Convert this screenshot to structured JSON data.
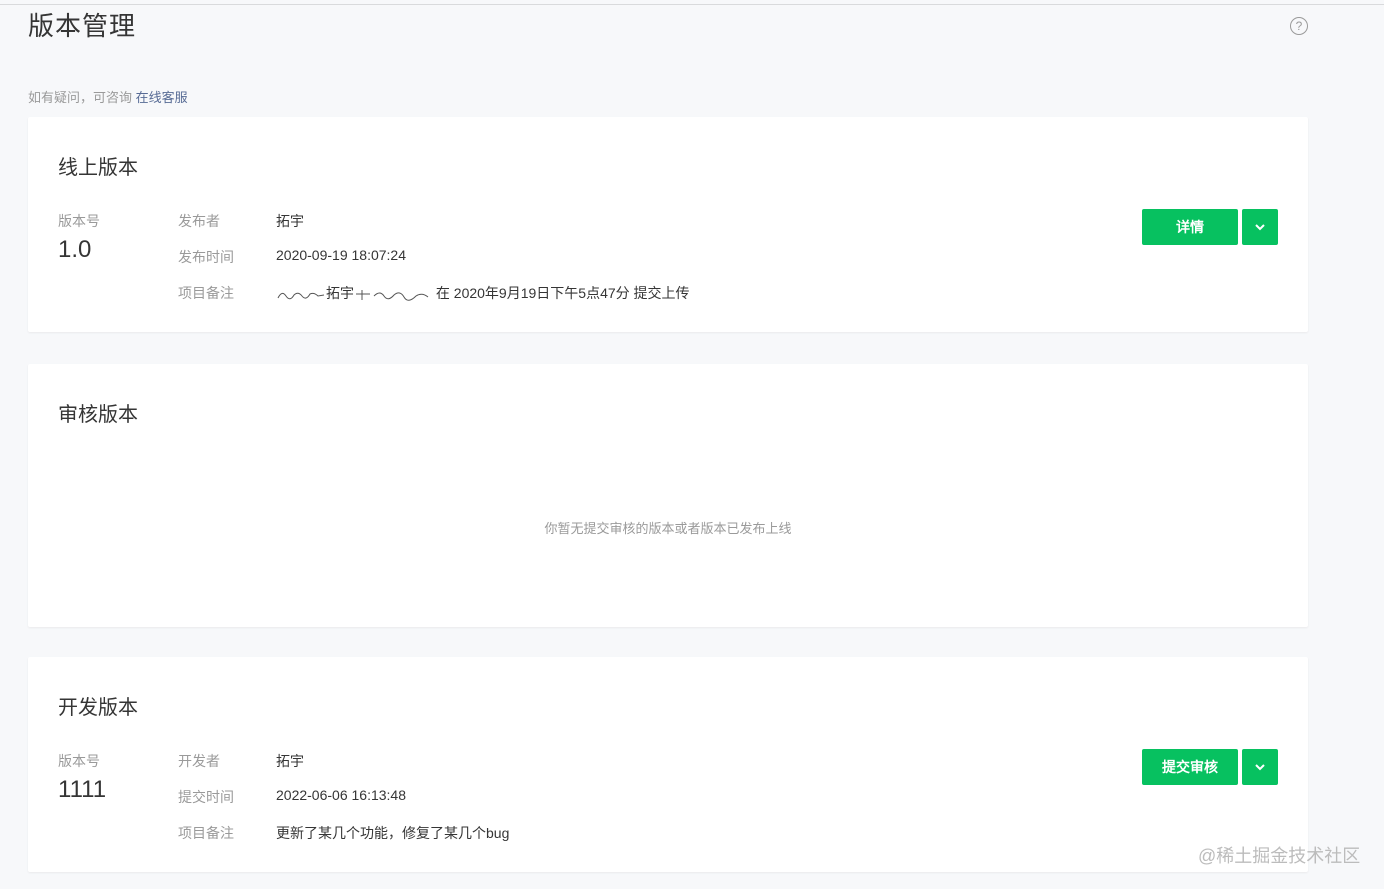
{
  "page": {
    "title": "版本管理",
    "help_text": "如有疑问，可咨询",
    "help_link": "在线客服",
    "help_icon": "question-circle-icon"
  },
  "online": {
    "title": "线上版本",
    "version_label": "版本号",
    "version": "1.0",
    "publisher_label": "发布者",
    "publisher": "拓宇",
    "time_label": "发布时间",
    "time": "2020-09-19 18:07:24",
    "note_label": "项目备注",
    "note_name": "拓宇",
    "note_suffix": "在 2020年9月19日下午5点47分 提交上传",
    "detail_button": "详情",
    "dropdown_icon": "chevron-down-icon"
  },
  "review": {
    "title": "审核版本",
    "empty_text": "你暂无提交审核的版本或者版本已发布上线"
  },
  "dev": {
    "title": "开发版本",
    "version_label": "版本号",
    "version": "1111",
    "developer_label": "开发者",
    "developer": "拓宇",
    "time_label": "提交时间",
    "time": "2022-06-06 16:13:48",
    "note_label": "项目备注",
    "note": "更新了某几个功能，修复了某几个bug",
    "submit_button": "提交审核",
    "dropdown_icon": "chevron-down-icon"
  },
  "watermark": "@稀土掘金技术社区",
  "colors": {
    "primary": "#07c160",
    "link": "#576b95",
    "muted": "#9a9a9a",
    "text": "#353535",
    "background": "#f7f8fa"
  }
}
